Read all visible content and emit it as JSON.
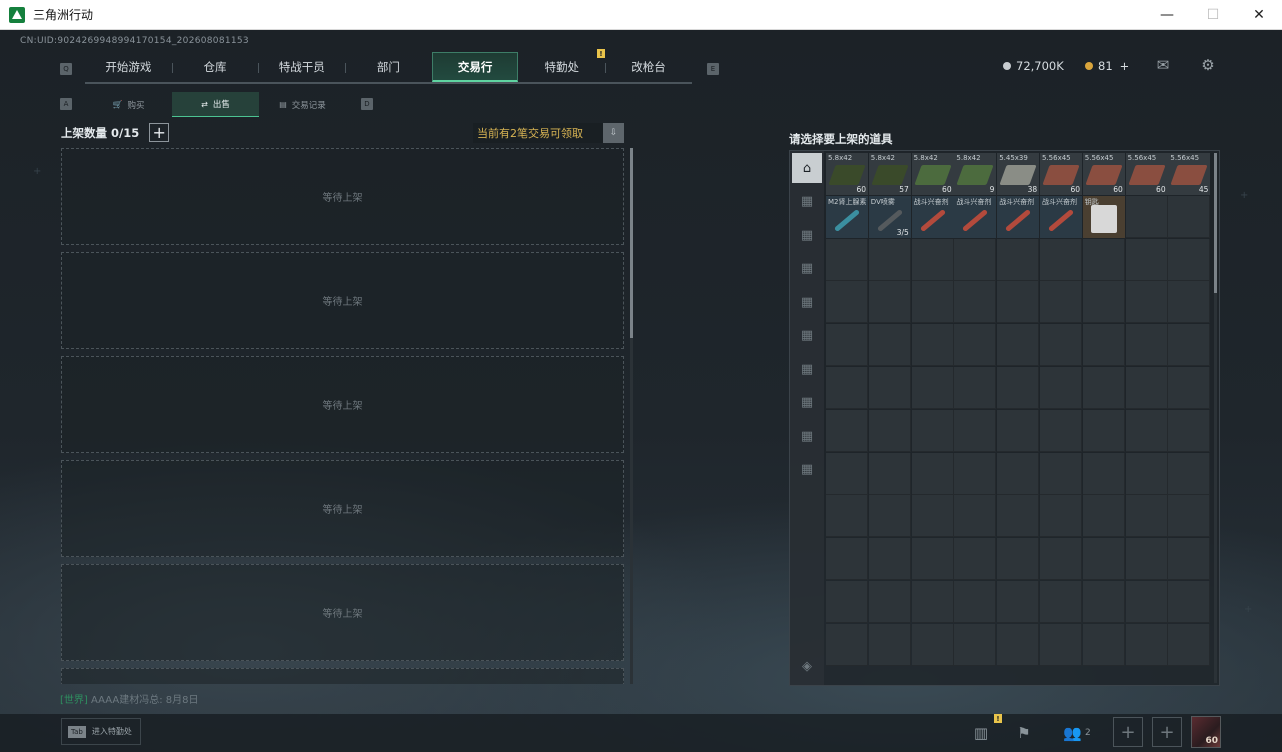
{
  "window": {
    "title": "三角洲行动",
    "minimize": "—",
    "maximize": "☐",
    "close": "✕"
  },
  "uid_text": "CN:UID:9024269948994170154_202608081153",
  "nav": {
    "key_left": "Q",
    "key_right": "E",
    "tabs": [
      "开始游戏",
      "仓库",
      "特战干员",
      "部门",
      "交易行",
      "特勤处",
      "改枪台"
    ],
    "active_index": 4,
    "badge": "!"
  },
  "currency": {
    "money": "72,700K",
    "coupons": "81",
    "coupons_plus": "+",
    "money_color": "#c7ccd0",
    "coupon_color": "#d9a53c"
  },
  "subnav": {
    "key_left": "A",
    "key_right": "D",
    "tabs": [
      {
        "label": "购买",
        "icon": "cart-icon"
      },
      {
        "label": "出售",
        "icon": "sell-icon"
      },
      {
        "label": "交易记录",
        "icon": "record-icon"
      }
    ],
    "active_index": 1
  },
  "listing": {
    "title": "上架数量 0/15",
    "add_label": "+",
    "claim_text": "当前有2笔交易可领取",
    "claim_icon": "claim-icon",
    "slots": [
      "等待上架",
      "等待上架",
      "等待上架",
      "等待上架",
      "等待上架"
    ]
  },
  "chat": {
    "channel": "[世界]",
    "message": "AAAA建材冯总: 8月8日"
  },
  "inventory": {
    "title": "请选择要上架的道具",
    "categories": [
      "all-icon",
      "ammo-icon",
      "ammo-icon",
      "ammo-icon",
      "ammo-icon",
      "ammo-icon",
      "ammo-icon",
      "ammo-icon",
      "ammo-icon",
      "ammo-icon"
    ],
    "layers_icon": "layers-icon",
    "items": [
      {
        "name": "5.8x42",
        "qty": "60",
        "color": "#3a4a2a"
      },
      {
        "name": "5.8x42",
        "qty": "57",
        "color": "#3a4a2a"
      },
      {
        "name": "5.8x42",
        "qty": "60",
        "color": "#4c6b3e"
      },
      {
        "name": "5.8x42",
        "qty": "9",
        "color": "#4c6b3e"
      },
      {
        "name": "5.45x39",
        "qty": "38",
        "color": "#8a8d86"
      },
      {
        "name": "5.56x45",
        "qty": "60",
        "color": "#8a4e40"
      },
      {
        "name": "5.56x45",
        "qty": "60",
        "color": "#8a4e40"
      },
      {
        "name": "5.56x45",
        "qty": "60",
        "color": "#8a4e40"
      },
      {
        "name": "5.56x45",
        "qty": "45",
        "color": "#8a4e40"
      },
      {
        "name": "M2肾上腺素",
        "qty": "",
        "color": "#3b8fa0"
      },
      {
        "name": "DV喷雾",
        "qty": "3/5",
        "color": "#555a5d"
      },
      {
        "name": "战斗兴奋剂",
        "qty": "",
        "color": "#b34a3c"
      },
      {
        "name": "战斗兴奋剂",
        "qty": "",
        "color": "#b34a3c"
      },
      {
        "name": "战斗兴奋剂",
        "qty": "",
        "color": "#b34a3c"
      },
      {
        "name": "战斗兴奋剂",
        "qty": "",
        "color": "#b34a3c"
      },
      {
        "name": "钥匙",
        "qty": "",
        "color": "#d8d8d8"
      }
    ]
  },
  "bottombar": {
    "tab_key": "Tab",
    "tab_label": "进入特勤处",
    "team_count": "2",
    "level": "60",
    "badge": "!"
  }
}
